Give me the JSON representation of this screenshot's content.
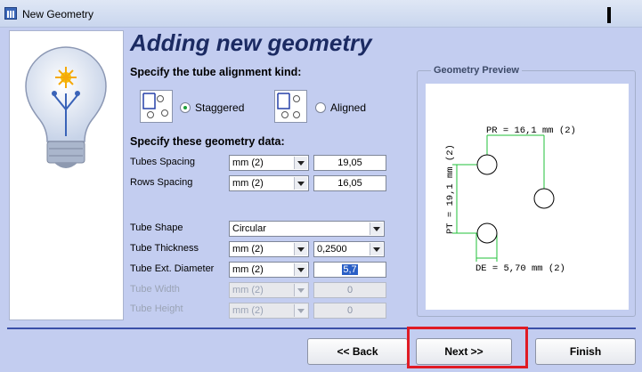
{
  "window": {
    "title": "New Geometry",
    "icon": "app-window-icon"
  },
  "heading": "Adding new geometry",
  "alignment": {
    "label": "Specify the tube alignment kind:",
    "options": [
      {
        "label": "Staggered",
        "selected": true
      },
      {
        "label": "Aligned",
        "selected": false
      }
    ]
  },
  "geometry": {
    "label": "Specify these geometry data:",
    "fields": {
      "tubes_spacing": {
        "label": "Tubes Spacing",
        "unit": "mm (2)",
        "value": "19,05"
      },
      "rows_spacing": {
        "label": "Rows Spacing",
        "unit": "mm (2)",
        "value": "16,05"
      },
      "tube_shape": {
        "label": "Tube Shape",
        "value": "Circular"
      },
      "tube_thickness": {
        "label": "Tube Thickness",
        "unit": "mm (2)",
        "value": "0,2500"
      },
      "tube_ext_diameter": {
        "label": "Tube Ext. Diameter",
        "unit": "mm (2)",
        "value": "5,7"
      },
      "tube_width": {
        "label": "Tube Width",
        "unit": "mm (2)",
        "value": "0",
        "disabled": true
      },
      "tube_height": {
        "label": "Tube Height",
        "unit": "mm (2)",
        "value": "0",
        "disabled": true
      }
    }
  },
  "preview": {
    "caption": "Geometry Preview",
    "pr_label": "PR = 16,1 mm (2)",
    "pt_label": "PT = 19,1 mm (2)",
    "de_label": "DE = 5,70 mm (2)",
    "dimension_color": "#22c03a"
  },
  "buttons": {
    "back": "<< Back",
    "next": "Next >>",
    "finish": "Finish"
  },
  "colors": {
    "background": "#c3cdf0",
    "heading": "#1b2a62",
    "highlight": "#e01b24",
    "selection": "#2a5fc6"
  }
}
